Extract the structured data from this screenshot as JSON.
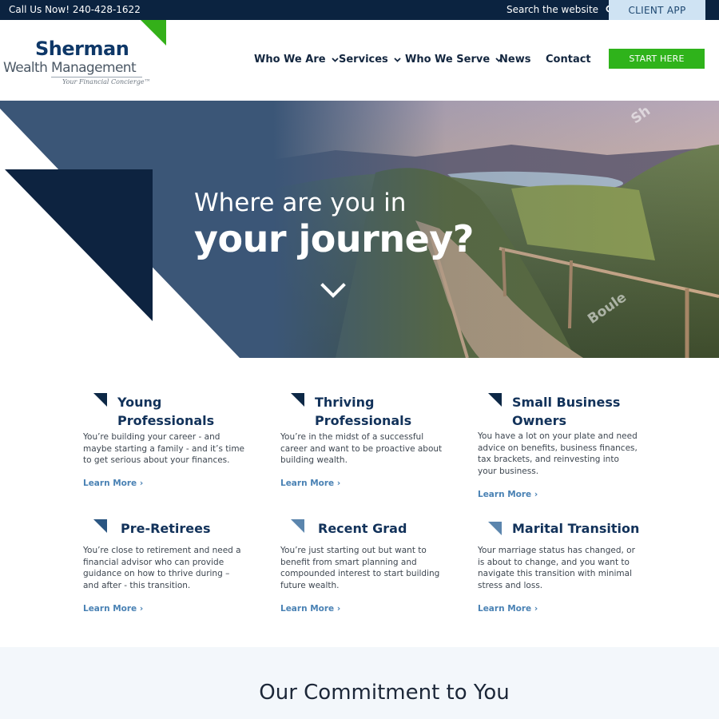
{
  "topbar": {
    "phone": "Call Us Now! 240-428-1622",
    "search_label": "Search the website",
    "client_app": "CLIENT APP"
  },
  "logo": {
    "line1": "Sherman",
    "line2": "Wealth Management",
    "tagline": "Your Financial Concierge™"
  },
  "nav": {
    "items": [
      {
        "label": "Who We Are",
        "has_dropdown": true
      },
      {
        "label": "Services",
        "has_dropdown": true
      },
      {
        "label": "Who We Serve",
        "has_dropdown": true
      },
      {
        "label": "News",
        "has_dropdown": false
      },
      {
        "label": "Contact",
        "has_dropdown": false
      }
    ],
    "start_button": "START HERE"
  },
  "hero": {
    "title_line1": "Where are you in",
    "title_line2": "your journey?",
    "watermark1": "Sh",
    "watermark2": "Boule"
  },
  "cards": [
    {
      "title": "Young Professionals",
      "text": "You’re building your career - and maybe starting a family - and it’s time to get serious about your finances.",
      "link": "Learn More ›"
    },
    {
      "title": "Thriving Professionals",
      "text": "You’re in the midst of a successful career and want to be proactive about building wealth.",
      "link": "Learn More ›"
    },
    {
      "title": "Small Business Owners",
      "text": "You have a lot on your plate and need advice on benefits, business finances, tax brackets, and reinvesting into your business.",
      "link": "Learn More ›"
    },
    {
      "title": "Pre-Retirees",
      "text": "You’re close to retirement and need a financial advisor who can provide guidance on how to thrive during – and after - this transition.",
      "link": "Learn More ›"
    },
    {
      "title": "Recent Grad",
      "text": "You’re just starting out but want to benefit from smart planning and compounded interest to start building future wealth.",
      "link": "Learn More ›"
    },
    {
      "title": "Marital Transition",
      "text": "Your marriage status has changed, or is about to change, and you want to navigate this transition with minimal stress and loss.",
      "link": "Learn More ›"
    }
  ],
  "commitment": {
    "title": "Our Commitment to You"
  },
  "colors": {
    "navy": "#0b2340",
    "green": "#2fb31b",
    "link_blue": "#4a82b4",
    "light_blue": "#cfe3f3"
  }
}
